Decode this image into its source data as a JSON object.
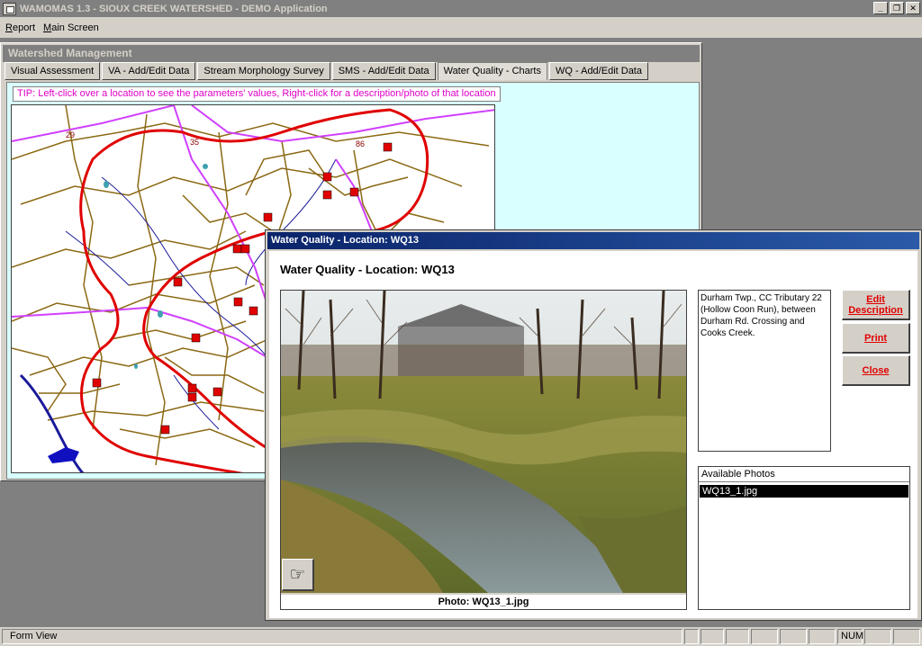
{
  "window": {
    "title": "WAMOMAS 1.3 - SIOUX CREEK WATERSHED - DEMO Application"
  },
  "menu": [
    "Report",
    "Main Screen"
  ],
  "form": {
    "title": "Watershed Management",
    "tabs": [
      {
        "label": "Visual Assessment",
        "active": false
      },
      {
        "label": "VA - Add/Edit Data",
        "active": false
      },
      {
        "label": "Stream Morphology Survey",
        "active": false
      },
      {
        "label": "SMS - Add/Edit Data",
        "active": false
      },
      {
        "label": "Water Quality - Charts",
        "active": true
      },
      {
        "label": "WQ - Add/Edit Data",
        "active": false
      }
    ],
    "tip": "TIP: Left-click over a location to see  the parameters' values, Right-click for a description/photo of that location",
    "map_labels": [
      "29",
      "35",
      "86"
    ]
  },
  "dialog": {
    "title": "Water Quality -  Location: WQ13",
    "heading": "Water Quality -  Location: WQ13",
    "description": "Durham Twp., CC Tributary 22 (Hollow Coon Run), between Durham Rd. Crossing and Cooks Creek.",
    "photo_caption": "Photo: WQ13_1.jpg",
    "buttons": {
      "edit": "Edit Description",
      "print": "Print",
      "close": "Close"
    },
    "photos_header": "Available Photos",
    "photos": [
      "WQ13_1.jpg"
    ]
  },
  "status": {
    "text": "Form View",
    "num": "NUM"
  },
  "colors": {
    "dialog_caption": "#0a246a",
    "tab_body": "#d9ffff",
    "tip_text": "#e000c8",
    "button_text": "#e00000",
    "watershed_boundary": "#e00000",
    "roads": "#8b6914",
    "highways": "#d040ff",
    "streams": "#1a1a9a"
  }
}
